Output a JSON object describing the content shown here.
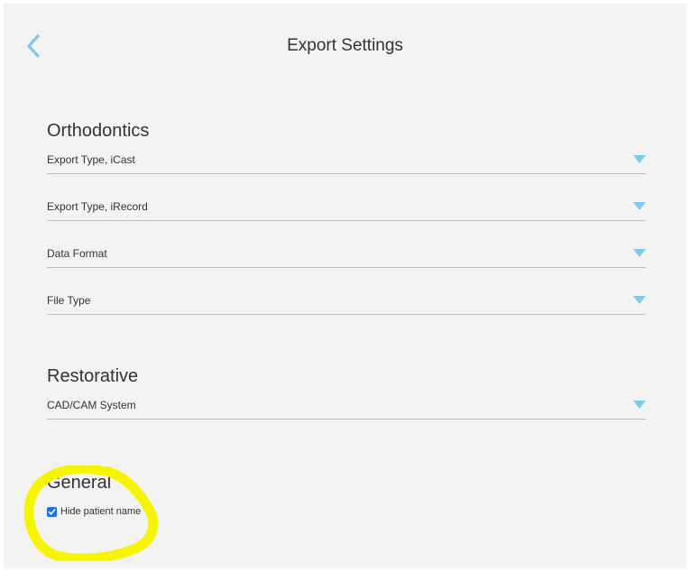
{
  "header": {
    "title": "Export Settings",
    "back_icon": "chevron-left-icon",
    "accent_color": "#7fc8ee"
  },
  "orthodontics": {
    "title": "Orthodontics",
    "fields": [
      {
        "label": "Export Type, iCast"
      },
      {
        "label": "Export Type, iRecord"
      },
      {
        "label": "Data Format"
      },
      {
        "label": "File Type"
      }
    ]
  },
  "restorative": {
    "title": "Restorative",
    "fields": [
      {
        "label": "CAD/CAM System"
      }
    ]
  },
  "general": {
    "title": "General",
    "hide_patient_name": {
      "label": "Hide patient name",
      "checked": true
    }
  },
  "annotation": {
    "color": "#f5f500"
  }
}
